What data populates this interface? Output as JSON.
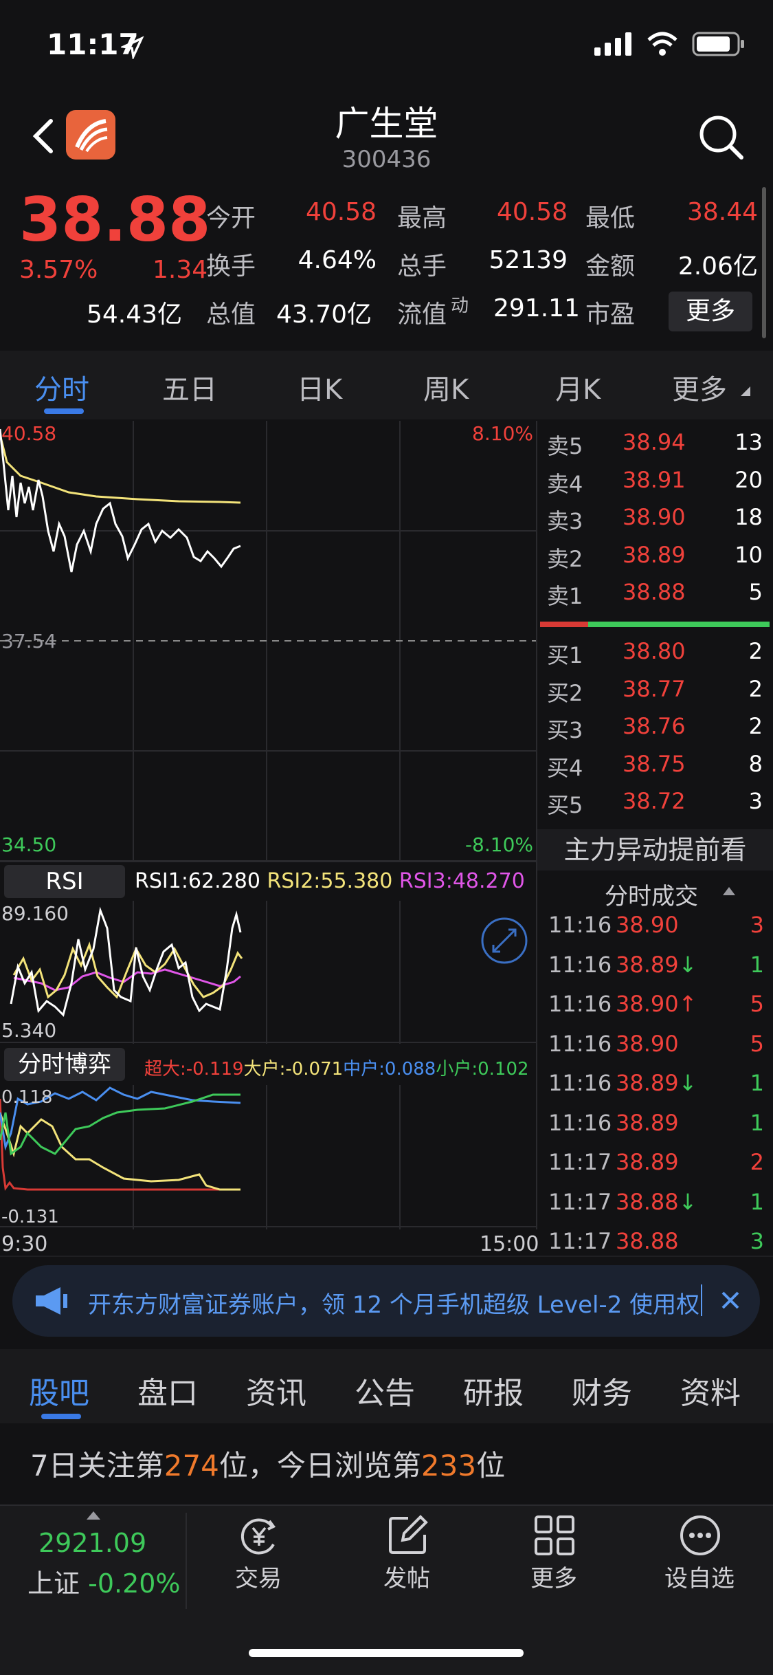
{
  "status": {
    "time": "11:17"
  },
  "header": {
    "title": "广生堂",
    "code": "300436"
  },
  "quote": {
    "price": "38.88",
    "change_pct": "3.57%",
    "change": "1.34",
    "stats": [
      {
        "label": "今开",
        "value": "40.58",
        "color": "#f0413b"
      },
      {
        "label": "最高",
        "value": "40.58",
        "color": "#f0413b"
      },
      {
        "label": "最低",
        "value": "38.44",
        "color": "#f0413b"
      },
      {
        "label": "换手",
        "value": "4.64%",
        "color": "#ffffff"
      },
      {
        "label": "总手",
        "value": "52139",
        "color": "#ffffff"
      },
      {
        "label": "金额",
        "value": "2.06亿",
        "color": "#ffffff"
      },
      {
        "label": "总值",
        "value": "54.43亿",
        "color": "#ffffff"
      },
      {
        "label": "流值",
        "value": "43.70亿",
        "color": "#ffffff"
      },
      {
        "label": "市盈",
        "value": "291.11",
        "color": "#ffffff"
      }
    ],
    "pe_superscript": "动",
    "more_label": "更多"
  },
  "chart_tabs": [
    "分时",
    "五日",
    "日K",
    "周K",
    "月K",
    "更多"
  ],
  "intraday": {
    "top_price": "40.58",
    "top_pct": "8.10%",
    "ref_price": "37.54",
    "bottom_price": "34.50",
    "bottom_pct": "-8.10%"
  },
  "order_book": {
    "sell": [
      {
        "label": "卖5",
        "price": "38.94",
        "volume": "13"
      },
      {
        "label": "卖4",
        "price": "38.91",
        "volume": "20"
      },
      {
        "label": "卖3",
        "price": "38.90",
        "volume": "18"
      },
      {
        "label": "卖2",
        "price": "38.89",
        "volume": "10"
      },
      {
        "label": "卖1",
        "price": "38.88",
        "volume": "5"
      }
    ],
    "buy": [
      {
        "label": "买1",
        "price": "38.80",
        "volume": "2"
      },
      {
        "label": "买2",
        "price": "38.77",
        "volume": "2"
      },
      {
        "label": "买3",
        "price": "38.76",
        "volume": "2"
      },
      {
        "label": "买4",
        "price": "38.75",
        "volume": "8"
      },
      {
        "label": "买5",
        "price": "38.72",
        "volume": "3"
      }
    ],
    "promo": "主力异动提前看"
  },
  "trades": {
    "title": "分时成交",
    "rows": [
      {
        "time": "11:16",
        "price": "38.90",
        "arrow": "",
        "volume": "3",
        "vcolor": "#f0413b"
      },
      {
        "time": "11:16",
        "price": "38.89",
        "arrow": "↓",
        "volume": "1",
        "vcolor": "#3ec95a"
      },
      {
        "time": "11:16",
        "price": "38.90",
        "arrow": "↑",
        "volume": "5",
        "vcolor": "#f0413b"
      },
      {
        "time": "11:16",
        "price": "38.90",
        "arrow": "",
        "volume": "5",
        "vcolor": "#f0413b"
      },
      {
        "time": "11:16",
        "price": "38.89",
        "arrow": "↓",
        "volume": "1",
        "vcolor": "#3ec95a"
      },
      {
        "time": "11:16",
        "price": "38.89",
        "arrow": "",
        "volume": "1",
        "vcolor": "#3ec95a"
      },
      {
        "time": "11:17",
        "price": "38.89",
        "arrow": "",
        "volume": "2",
        "vcolor": "#f0413b"
      },
      {
        "time": "11:17",
        "price": "38.88",
        "arrow": "↓",
        "volume": "1",
        "vcolor": "#3ec95a"
      },
      {
        "time": "11:17",
        "price": "38.88",
        "arrow": "",
        "volume": "3",
        "vcolor": "#3ec95a"
      }
    ]
  },
  "rsi": {
    "button": "RSI",
    "rsi1": "RSI1:62.280",
    "rsi2": "RSI2:55.380",
    "rsi3": "RSI3:48.270",
    "top": "89.160",
    "bottom": "5.340"
  },
  "fenshi_boyi": {
    "button": "分时博弈",
    "chaoda": "超大:-0.119",
    "dahu": "大户:-0.071",
    "zhonghu": "中户:0.088",
    "xiaohu": "小户:0.102",
    "top": "0.118",
    "bottom": "-0.131",
    "time_start": "9:30",
    "time_end": "15:00"
  },
  "banner": {
    "text": "开东方财富证券账户，领 12 个月手机超级 Level-2 使用权"
  },
  "info_tabs": [
    "股吧",
    "盘口",
    "资讯",
    "公告",
    "研报",
    "财务",
    "资料"
  ],
  "rank": {
    "prefix": "7日关注第",
    "follow_rank": "274",
    "mid": "位，今日浏览第",
    "view_rank": "233",
    "suffix": "位"
  },
  "bottom_nav": {
    "index_value": "2921.09",
    "index_name": "上证",
    "index_change": "-0.20%",
    "items": [
      "交易",
      "发帖",
      "更多",
      "设自选"
    ]
  },
  "colors": {
    "up": "#f0413b",
    "down": "#3ec95a",
    "accent": "#4a8ff0"
  }
}
